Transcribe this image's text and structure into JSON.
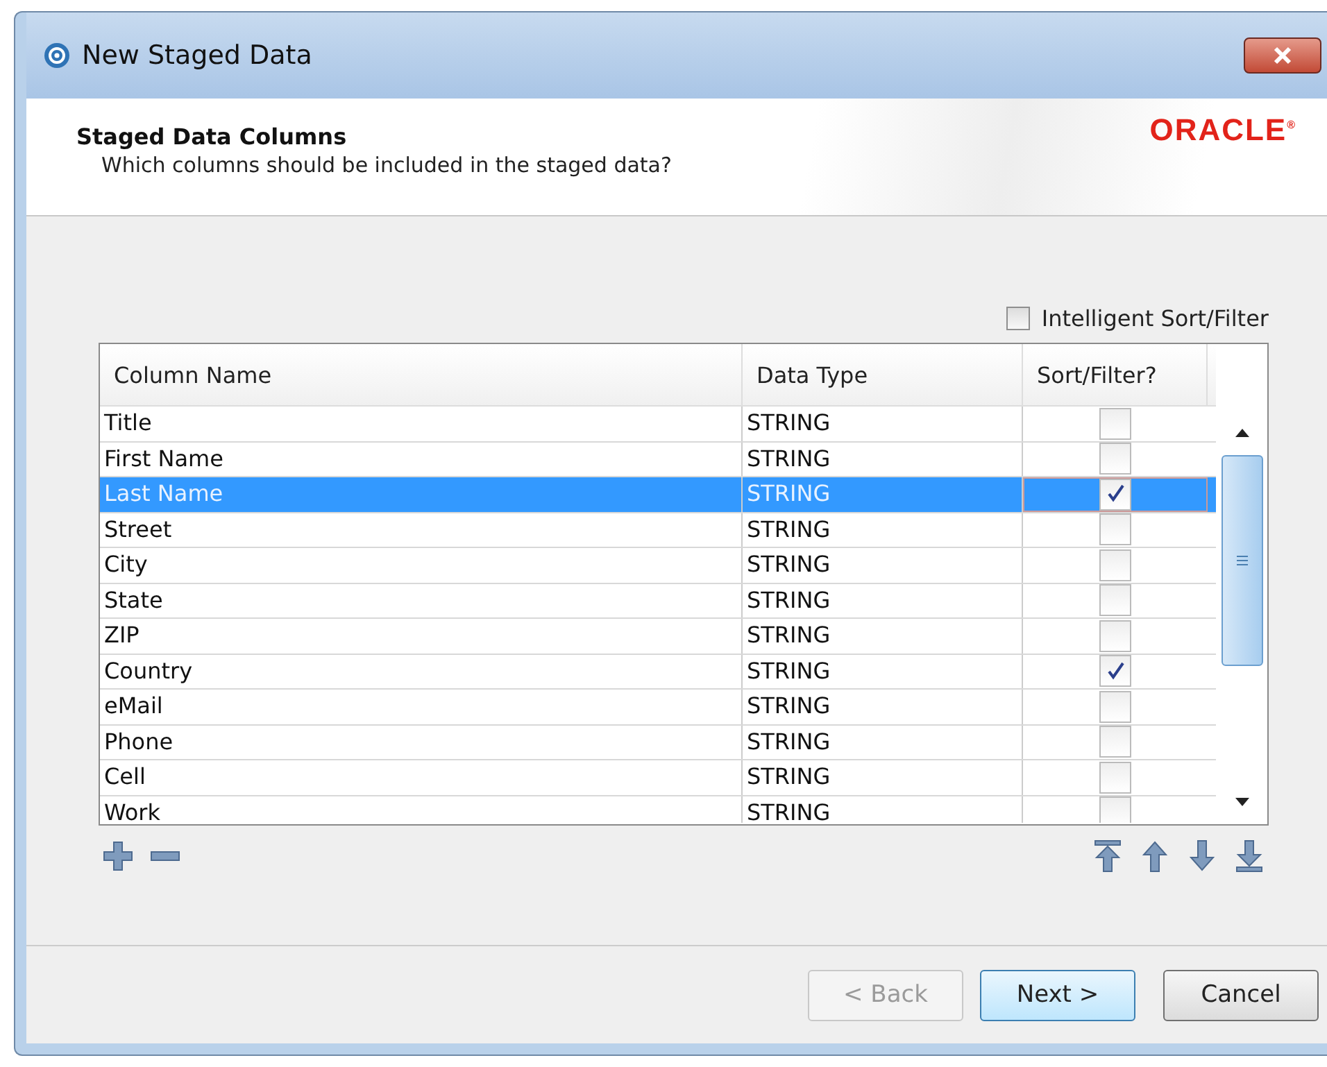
{
  "window": {
    "title": "New Staged Data"
  },
  "header": {
    "title": "Staged Data Columns",
    "subtitle": "Which columns should be included in the staged data?",
    "logo": "ORACLE$^{®}$"
  },
  "intelligent_sort_filter": {
    "label": "Intelligent Sort/Filter",
    "checked": false
  },
  "table": {
    "columns": [
      "Column Name",
      "Data Type",
      "Sort/Filter?"
    ],
    "rows": [
      {
        "name": "Title",
        "type": "STRING",
        "sort_filter": false,
        "selected": false
      },
      {
        "name": "First Name",
        "type": "STRING",
        "sort_filter": false,
        "selected": false
      },
      {
        "name": "Last Name",
        "type": "STRING",
        "sort_filter": true,
        "selected": true
      },
      {
        "name": "Street",
        "type": "STRING",
        "sort_filter": false,
        "selected": false
      },
      {
        "name": "City",
        "type": "STRING",
        "sort_filter": false,
        "selected": false
      },
      {
        "name": "State",
        "type": "STRING",
        "sort_filter": false,
        "selected": false
      },
      {
        "name": "ZIP",
        "type": "STRING",
        "sort_filter": false,
        "selected": false
      },
      {
        "name": "Country",
        "type": "STRING",
        "sort_filter": true,
        "selected": false
      },
      {
        "name": "eMail",
        "type": "STRING",
        "sort_filter": false,
        "selected": false
      },
      {
        "name": "Phone",
        "type": "STRING",
        "sort_filter": false,
        "selected": false
      },
      {
        "name": "Cell",
        "type": "STRING",
        "sort_filter": false,
        "selected": false
      },
      {
        "name": "Work",
        "type": "STRING",
        "sort_filter": false,
        "selected": false
      }
    ]
  },
  "buttons": [
    {
      "label": "< Back",
      "disabled": true,
      "default": false
    },
    {
      "label": "Next >",
      "disabled": false,
      "default": true
    },
    {
      "label": "Cancel",
      "disabled": false,
      "default": false
    }
  ]
}
